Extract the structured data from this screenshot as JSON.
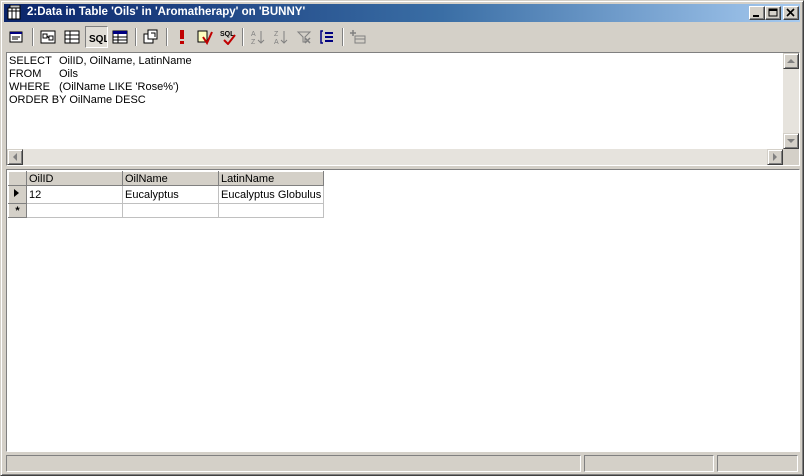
{
  "window": {
    "title": "2:Data in Table 'Oils' in 'Aromatherapy' on 'BUNNY'"
  },
  "toolbar": {
    "buttons": [
      "properties-icon",
      "diagram-pane-icon",
      "grid-pane-icon",
      "sql-pane-icon",
      "results-pane-icon",
      "change-type-icon",
      "run-icon",
      "verify-sql-icon",
      "check-sql-icon",
      "sort-ascending-icon",
      "sort-descending-icon",
      "remove-filter-icon",
      "group-by-icon",
      "add-table-icon"
    ]
  },
  "sql": {
    "lines": [
      {
        "keyword": "SELECT",
        "text": "OilID, OilName, LatinName"
      },
      {
        "keyword": "FROM",
        "text": "Oils"
      },
      {
        "keyword": "WHERE",
        "text": "(OilName LIKE 'Rose%')"
      },
      {
        "keyword": "ORDER BY",
        "text": "OilName DESC"
      }
    ]
  },
  "grid": {
    "columns": [
      "OilID",
      "OilName",
      "LatinName"
    ],
    "rows": [
      {
        "OilID": "12",
        "OilName": "Eucalyptus",
        "LatinName": "Eucalyptus Globulus"
      }
    ],
    "new_row_marker": "*"
  },
  "status": {
    "panels": [
      "",
      "",
      ""
    ]
  }
}
